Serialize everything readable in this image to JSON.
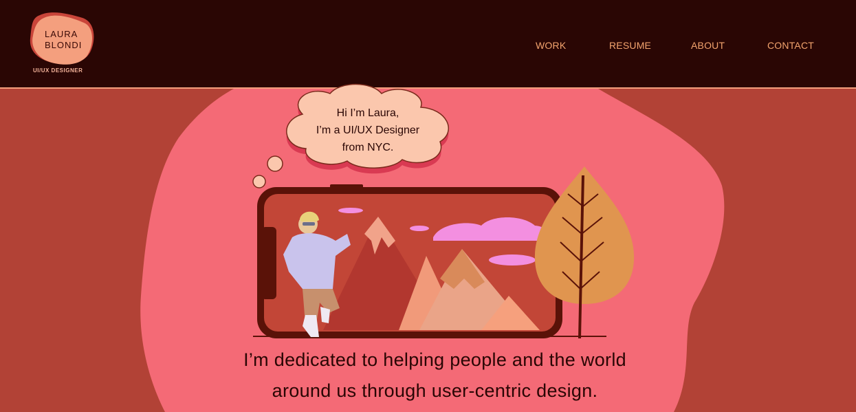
{
  "logo": {
    "line1": "LAURA",
    "line2": "BLONDI",
    "tagline": "UI/UX DESIGNER"
  },
  "nav": {
    "items": [
      {
        "label": "WORK"
      },
      {
        "label": "RESUME"
      },
      {
        "label": "ABOUT"
      },
      {
        "label": "CONTACT"
      }
    ]
  },
  "hero": {
    "bubble_lines": [
      "Hi I’m Laura,",
      "I’m a UI/UX Designer",
      "from NYC."
    ],
    "headline_lines": [
      "I’m dedicated to helping people and the world",
      "around us through user-centric design."
    ]
  },
  "colors": {
    "header_bg": "#2a0604",
    "page_bg": "#b24236",
    "blob": "#f46a76",
    "nav_text": "#f4a46e",
    "bubble": "#fbc7ad",
    "phone_frame": "#5a1208",
    "tree": "#e0954f"
  }
}
